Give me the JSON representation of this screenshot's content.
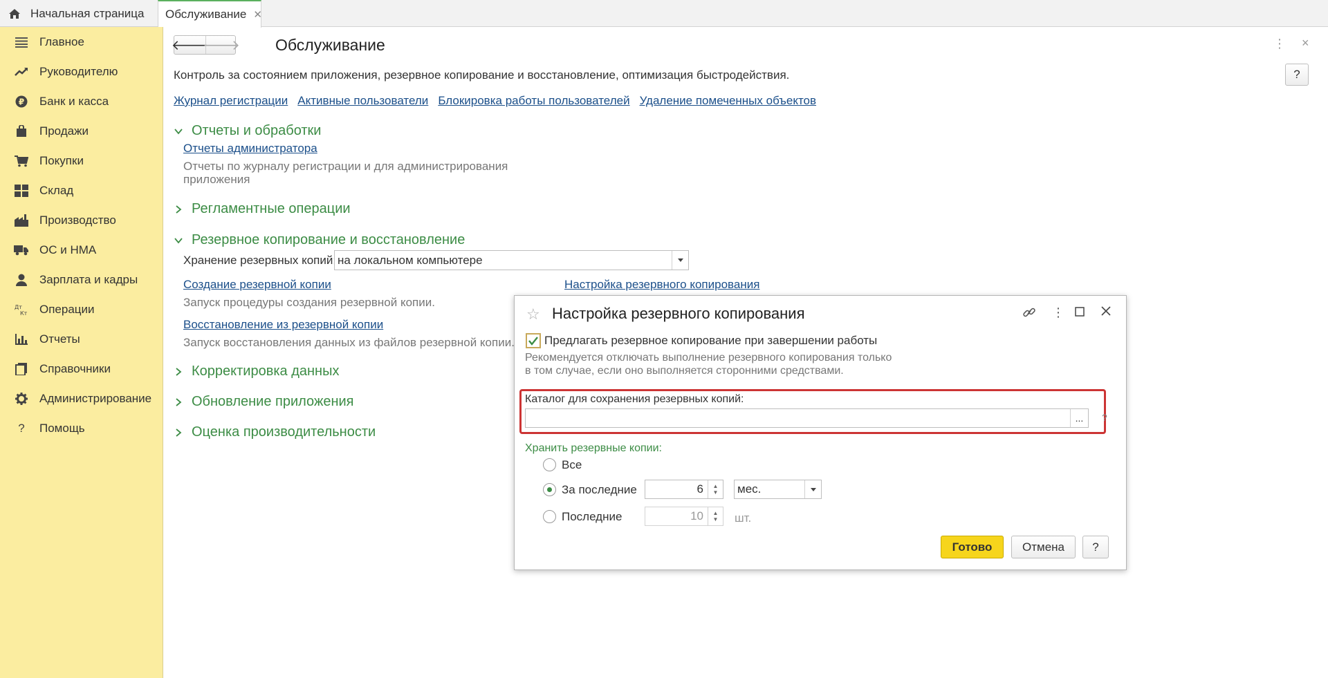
{
  "tabs": {
    "home_label": "Начальная страница",
    "active_label": "Обслуживание",
    "close_glyph": "✕"
  },
  "sidebar": {
    "items": [
      {
        "label": "Главное",
        "icon": "menu-icon"
      },
      {
        "label": "Руководителю",
        "icon": "trend-icon"
      },
      {
        "label": "Банк и касса",
        "icon": "ruble-icon"
      },
      {
        "label": "Продажи",
        "icon": "bag-icon"
      },
      {
        "label": "Покупки",
        "icon": "cart-icon"
      },
      {
        "label": "Склад",
        "icon": "warehouse-icon"
      },
      {
        "label": "Производство",
        "icon": "factory-icon"
      },
      {
        "label": "ОС и НМА",
        "icon": "truck-icon"
      },
      {
        "label": "Зарплата и кадры",
        "icon": "person-icon"
      },
      {
        "label": "Операции",
        "icon": "dt-kt-icon"
      },
      {
        "label": "Отчеты",
        "icon": "bar-chart-icon"
      },
      {
        "label": "Справочники",
        "icon": "book-icon"
      },
      {
        "label": "Администрирование",
        "icon": "gear-icon"
      },
      {
        "label": "Помощь",
        "icon": "question-icon"
      }
    ]
  },
  "main": {
    "title": "Обслуживание",
    "description": "Контроль за состоянием приложения, резервное копирование и восстановление, оптимизация быстродействия.",
    "help": "?",
    "links": [
      "Журнал регистрации",
      "Активные пользователи",
      "Блокировка работы пользователей",
      "Удаление помеченных объектов"
    ],
    "sections": {
      "reports": "Отчеты и обработки",
      "reports_link": "Отчеты администратора",
      "reports_text1": "Отчеты по журналу регистрации и для администрирования",
      "reports_text2": "приложения",
      "scheduled": "Регламентные операции",
      "backup": "Резервное копирование и восстановление",
      "backup_store_label": "Хранение резервных копий:",
      "backup_store_value": "на локальном компьютере",
      "create_link": "Создание резервной копии",
      "create_text": "Запуск процедуры создания резервной копии.",
      "restore_link": "Восстановление из резервной копии",
      "restore_text": "Запуск восстановления данных из файлов резервной копии.",
      "settings_link": "Настройка резервного копирования",
      "correction": "Корректировка данных",
      "update": "Обновление приложения",
      "performance": "Оценка производительности"
    }
  },
  "dialog": {
    "title": "Настройка резервного копирования",
    "checkbox_label": "Предлагать резервное копирование при завершении работы",
    "hint1": "Рекомендуется отключать выполнение резервного копирования только",
    "hint2": "в том случае, если оно выполняется сторонними средствами.",
    "catalog_label": "Каталог для сохранения резервных копий:",
    "catalog_value": "",
    "dots": "...",
    "catalog_q": "?",
    "keep_label": "Хранить резервные копии:",
    "options": [
      {
        "label": "Все",
        "selected": false
      },
      {
        "label": "За последние",
        "selected": true
      },
      {
        "label": "Последние",
        "selected": false
      }
    ],
    "months_value": "6",
    "months_unit": "мес.",
    "count_value": "10",
    "count_unit": "шт.",
    "ok_label": "Готово",
    "cancel_label": "Отмена",
    "help_label": "?"
  }
}
